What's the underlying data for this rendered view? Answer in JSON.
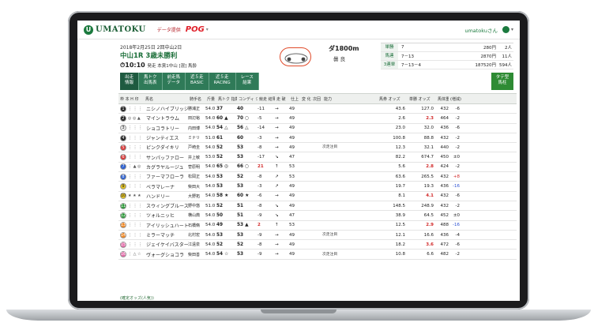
{
  "header": {
    "logo_mark": "U",
    "logo_text": "UMATOKU",
    "data_link": "データ提供",
    "pog": "POG",
    "pog_caret": "▾",
    "user_name": "umatokuさん",
    "user_caret": "▾"
  },
  "race": {
    "date": "2018年2月25日 2回中山2日",
    "title": "中山1R 3歳未勝利",
    "time": "10:10",
    "time_sub": "発走 本賞1中山 [混] 馬齢",
    "distance": "ダ1800m",
    "condition": "曇 良"
  },
  "odds": [
    {
      "k": "単勝",
      "c": "7",
      "p": "280円",
      "r": "2人"
    },
    {
      "k": "馬連",
      "c": "7－13",
      "p": "2870円",
      "r": "11人"
    },
    {
      "k": "3連単",
      "c": "7－13－4",
      "p": "187520円",
      "r": "594人"
    }
  ],
  "tabs": [
    {
      "l1": "出走",
      "l2": "情報",
      "active": true
    },
    {
      "l1": "馬トク",
      "l2": "出馬表",
      "active": false
    },
    {
      "l1": "前走馬",
      "l2": "データ",
      "active": false
    },
    {
      "l1": "近５走",
      "l2": "BASIC",
      "active": false
    },
    {
      "l1": "近５走",
      "l2": "RACING",
      "active": false
    },
    {
      "l1": "レース",
      "l2": "結果",
      "active": false
    }
  ],
  "tab_right": {
    "l1": "タテ型",
    "l2": "馬柱"
  },
  "table_headers": [
    "枠 本 H 印",
    "馬名",
    "騎手名",
    "斤量",
    "馬トク 指数",
    "コンディ ション指数",
    "競走 結果",
    "走 破",
    "仕上 り",
    "変 化",
    "次回",
    "能力",
    "馬券 オッズ",
    "単勝 オッズ",
    "馬体重",
    "(増減)"
  ],
  "rows": [
    {
      "n": "1",
      "c": "#222222",
      "marks": "⋮ ⋮ ⋮",
      "name": "ニシノハイブリッジ",
      "jockey": "勝浦正",
      "w": "54.0",
      "f1": "37",
      "f2": "40",
      "v": "-11",
      "r": "→",
      "x": "49",
      "note": "",
      "odds": "43.6",
      "odds2": "127.0",
      "hw": "432",
      "diff": "-6"
    },
    {
      "n": "2",
      "c": "#222222",
      "marks": "◎ ◎ ▲",
      "name": "マイントラウム",
      "jockey": "田辺裕",
      "w": "54.0",
      "f1": "60 ▲",
      "f2": "70 ○",
      "v": "-5",
      "r": "→",
      "x": "49",
      "note": "",
      "odds": "2.6",
      "odds2": "2.3",
      "hw": "464",
      "diff": "-2"
    },
    {
      "n": "3",
      "c": "#e9e9e9",
      "marks": "⋮ ⋮ ⋮",
      "name": "ショコラトリー",
      "jockey": "内田博",
      "w": "54.0",
      "f1": "54 △",
      "f2": "56 △",
      "v": "-14",
      "r": "→",
      "x": "49",
      "note": "",
      "odds": "23.0",
      "odds2": "32.0",
      "hw": "436",
      "diff": "-6"
    },
    {
      "n": "4",
      "c": "#222222",
      "marks": "⋮ ⋮ ⋮",
      "name": "ジャンティエス",
      "jockey": "ミナリ",
      "w": "51.0",
      "f1": "61",
      "f2": "60",
      "v": "-3",
      "r": "→",
      "x": "49",
      "note": "",
      "odds": "100.8",
      "odds2": "88.8",
      "hw": "432",
      "diff": "-2"
    },
    {
      "n": "5",
      "c": "#d93838",
      "marks": "⋮ ⋮ ⋮",
      "name": "ピンクダイキリ",
      "jockey": "戸崎圭",
      "w": "54.0",
      "f1": "52",
      "f2": "53",
      "v": "-8",
      "r": "→",
      "x": "49",
      "note": "次走注目",
      "odds": "12.3",
      "odds2": "32.1",
      "hw": "440",
      "diff": "-2"
    },
    {
      "n": "6",
      "c": "#d93838",
      "marks": "⋮ ⋮ ⋮",
      "name": "サンパッファロー",
      "jockey": "井上敏",
      "w": "53.0",
      "f1": "52",
      "f2": "53",
      "v": "-17",
      "r": "↘",
      "x": "47",
      "note": "",
      "odds": "82.2",
      "odds2": "674.7",
      "hw": "450",
      "diff": "±0"
    },
    {
      "n": "7",
      "c": "#2a5fd0",
      "marks": "⋮ ▲ ◎",
      "name": "カグラヤルージュ",
      "jockey": "菅原明",
      "w": "54.0",
      "f1": "65 ◎",
      "f2": "66 ○",
      "v": "21",
      "r": "↑",
      "x": "53",
      "note": "",
      "odds": "5.6",
      "odds2": "2.8",
      "hw": "424",
      "diff": "-2"
    },
    {
      "n": "8",
      "c": "#2a5fd0",
      "marks": "⋮ ⋮ ⋮",
      "name": "ファーマフローラ",
      "jockey": "松岡正",
      "w": "54.0",
      "f1": "53",
      "f2": "52",
      "v": "-8",
      "r": "↗",
      "x": "53",
      "note": "",
      "odds": "63.6",
      "odds2": "265.5",
      "hw": "432",
      "diff": "+8"
    },
    {
      "n": "9",
      "c": "#e0c020",
      "marks": "⋮ ⋮ ⋮",
      "name": "ベラマレーナ",
      "jockey": "柴田大",
      "w": "54.0",
      "f1": "53",
      "f2": "53",
      "v": "-3",
      "r": "↗",
      "x": "49",
      "note": "",
      "odds": "19.7",
      "odds2": "19.3",
      "hw": "436",
      "diff": "-16"
    },
    {
      "n": "10",
      "c": "#e0c020",
      "marks": "★ ★ ★",
      "name": "ハンドリー",
      "jockey": "大野拓",
      "w": "54.0",
      "f1": "58 ★",
      "f2": "60 ★",
      "v": "-6",
      "r": "→",
      "x": "49",
      "note": "",
      "odds": "8.1",
      "odds2": "4.1",
      "hw": "432",
      "diff": "-6"
    },
    {
      "n": "11",
      "c": "#2e9a3a",
      "marks": "⋮ ⋮ ⋮",
      "name": "スウィングブルース",
      "jockey": "野中悠",
      "w": "51.0",
      "f1": "52",
      "f2": "51",
      "v": "-8",
      "r": "↘",
      "x": "49",
      "note": "",
      "odds": "148.5",
      "odds2": "248.9",
      "hw": "432",
      "diff": "-2"
    },
    {
      "n": "12",
      "c": "#2e9a3a",
      "marks": "⋮ ⋮ ⋮",
      "name": "ツォルニッヒ",
      "jockey": "横山典",
      "w": "54.0",
      "f1": "50",
      "f2": "51",
      "v": "-9",
      "r": "↘",
      "x": "47",
      "note": "",
      "odds": "38.9",
      "odds2": "64.5",
      "hw": "452",
      "diff": "±0"
    },
    {
      "n": "13",
      "c": "#f08a28",
      "marks": "⋮ ⋮ ⋮",
      "name": "アイリッシュハート",
      "jockey": "石橋脩",
      "w": "54.0",
      "f1": "49",
      "f2": "53 ▲",
      "v": "2",
      "r": "↑",
      "x": "53",
      "note": "",
      "odds": "12.5",
      "odds2": "2.9",
      "hw": "488",
      "diff": "-16"
    },
    {
      "n": "14",
      "c": "#f08a28",
      "marks": "⋮ ⋮ ⋮",
      "name": "ミラーマッチ",
      "jockey": "北村宏",
      "w": "54.0",
      "f1": "53",
      "f2": "53",
      "v": "-9",
      "r": "→",
      "x": "49",
      "note": "次走注目",
      "odds": "12.1",
      "odds2": "16.6",
      "hw": "436",
      "diff": "-4"
    },
    {
      "n": "15",
      "c": "#e46aa8",
      "marks": "⋮ ⋮ ⋮",
      "name": "ジェイケイバスター",
      "jockey": "江遠泉",
      "w": "54.0",
      "f1": "52",
      "f2": "52",
      "v": "-8",
      "r": "→",
      "x": "49",
      "note": "",
      "odds": "18.2",
      "odds2": "3.6",
      "hw": "472",
      "diff": "-6"
    },
    {
      "n": "16",
      "c": "#e46aa8",
      "marks": "⋮ △ ☆",
      "name": "ヴォーグショコラ",
      "jockey": "柴田善",
      "w": "54.0",
      "f1": "54 ☆",
      "f2": "53",
      "v": "-9",
      "r": "→",
      "x": "49",
      "note": "次走注目",
      "odds": "10.8",
      "odds2": "6.6",
      "hw": "482",
      "diff": "-2"
    }
  ],
  "footnote": "(確定オッズ(人気))"
}
